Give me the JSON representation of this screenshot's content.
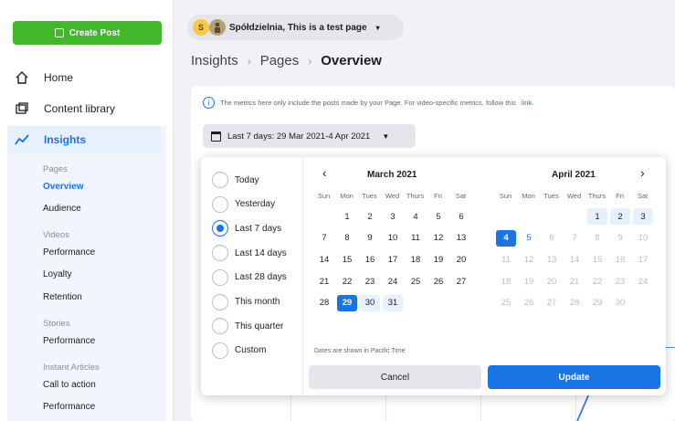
{
  "sidebar": {
    "create_label": "Create Post",
    "nav": [
      {
        "label": "Home",
        "icon": "home-icon"
      },
      {
        "label": "Content library",
        "icon": "content-library-icon"
      },
      {
        "label": "Insights",
        "icon": "insights-icon"
      }
    ],
    "sub": {
      "pages_header": "Pages",
      "overview": "Overview",
      "audience": "Audience",
      "videos_header": "Videos",
      "videos_performance": "Performance",
      "loyalty": "Loyalty",
      "retention": "Retention",
      "stories_header": "Stories",
      "stories_performance": "Performance",
      "instant_header": "Instant Articles",
      "call_to_action": "Call to action",
      "instant_performance": "Performance"
    }
  },
  "header": {
    "page_name": "Spółdzielnia, This is a test page",
    "avatar_letter": "S",
    "breadcrumb": [
      "Insights",
      "Pages",
      "Overview"
    ]
  },
  "info": {
    "text": "The metrics here only include the posts made by your Page. For video-specific metrics, follow this",
    "link": "link."
  },
  "date_button": {
    "label": "Last 7 days: 29 Mar 2021-4 Apr 2021"
  },
  "picker": {
    "options": [
      "Today",
      "Yesterday",
      "Last 7 days",
      "Last 14 days",
      "Last 28 days",
      "This month",
      "This quarter",
      "Custom"
    ],
    "selected_option": "Last 7 days",
    "months": [
      {
        "title": "March 2021",
        "weekdays": [
          "Sun",
          "Mon",
          "Tues",
          "Wed",
          "Thurs",
          "Fri",
          "Sat"
        ]
      },
      {
        "title": "April 2021",
        "weekdays": [
          "Sun",
          "Mon",
          "Tues",
          "Wed",
          "Thurs",
          "Fri",
          "Sat"
        ]
      }
    ],
    "tz_note": "Dates are shown in Pacific Time",
    "cancel": "Cancel",
    "update": "Update",
    "nav_prev": "‹",
    "nav_next": "›"
  },
  "colors": {
    "accent": "#1b74e4",
    "create": "#42b72a",
    "range": "#e7f0fd"
  }
}
